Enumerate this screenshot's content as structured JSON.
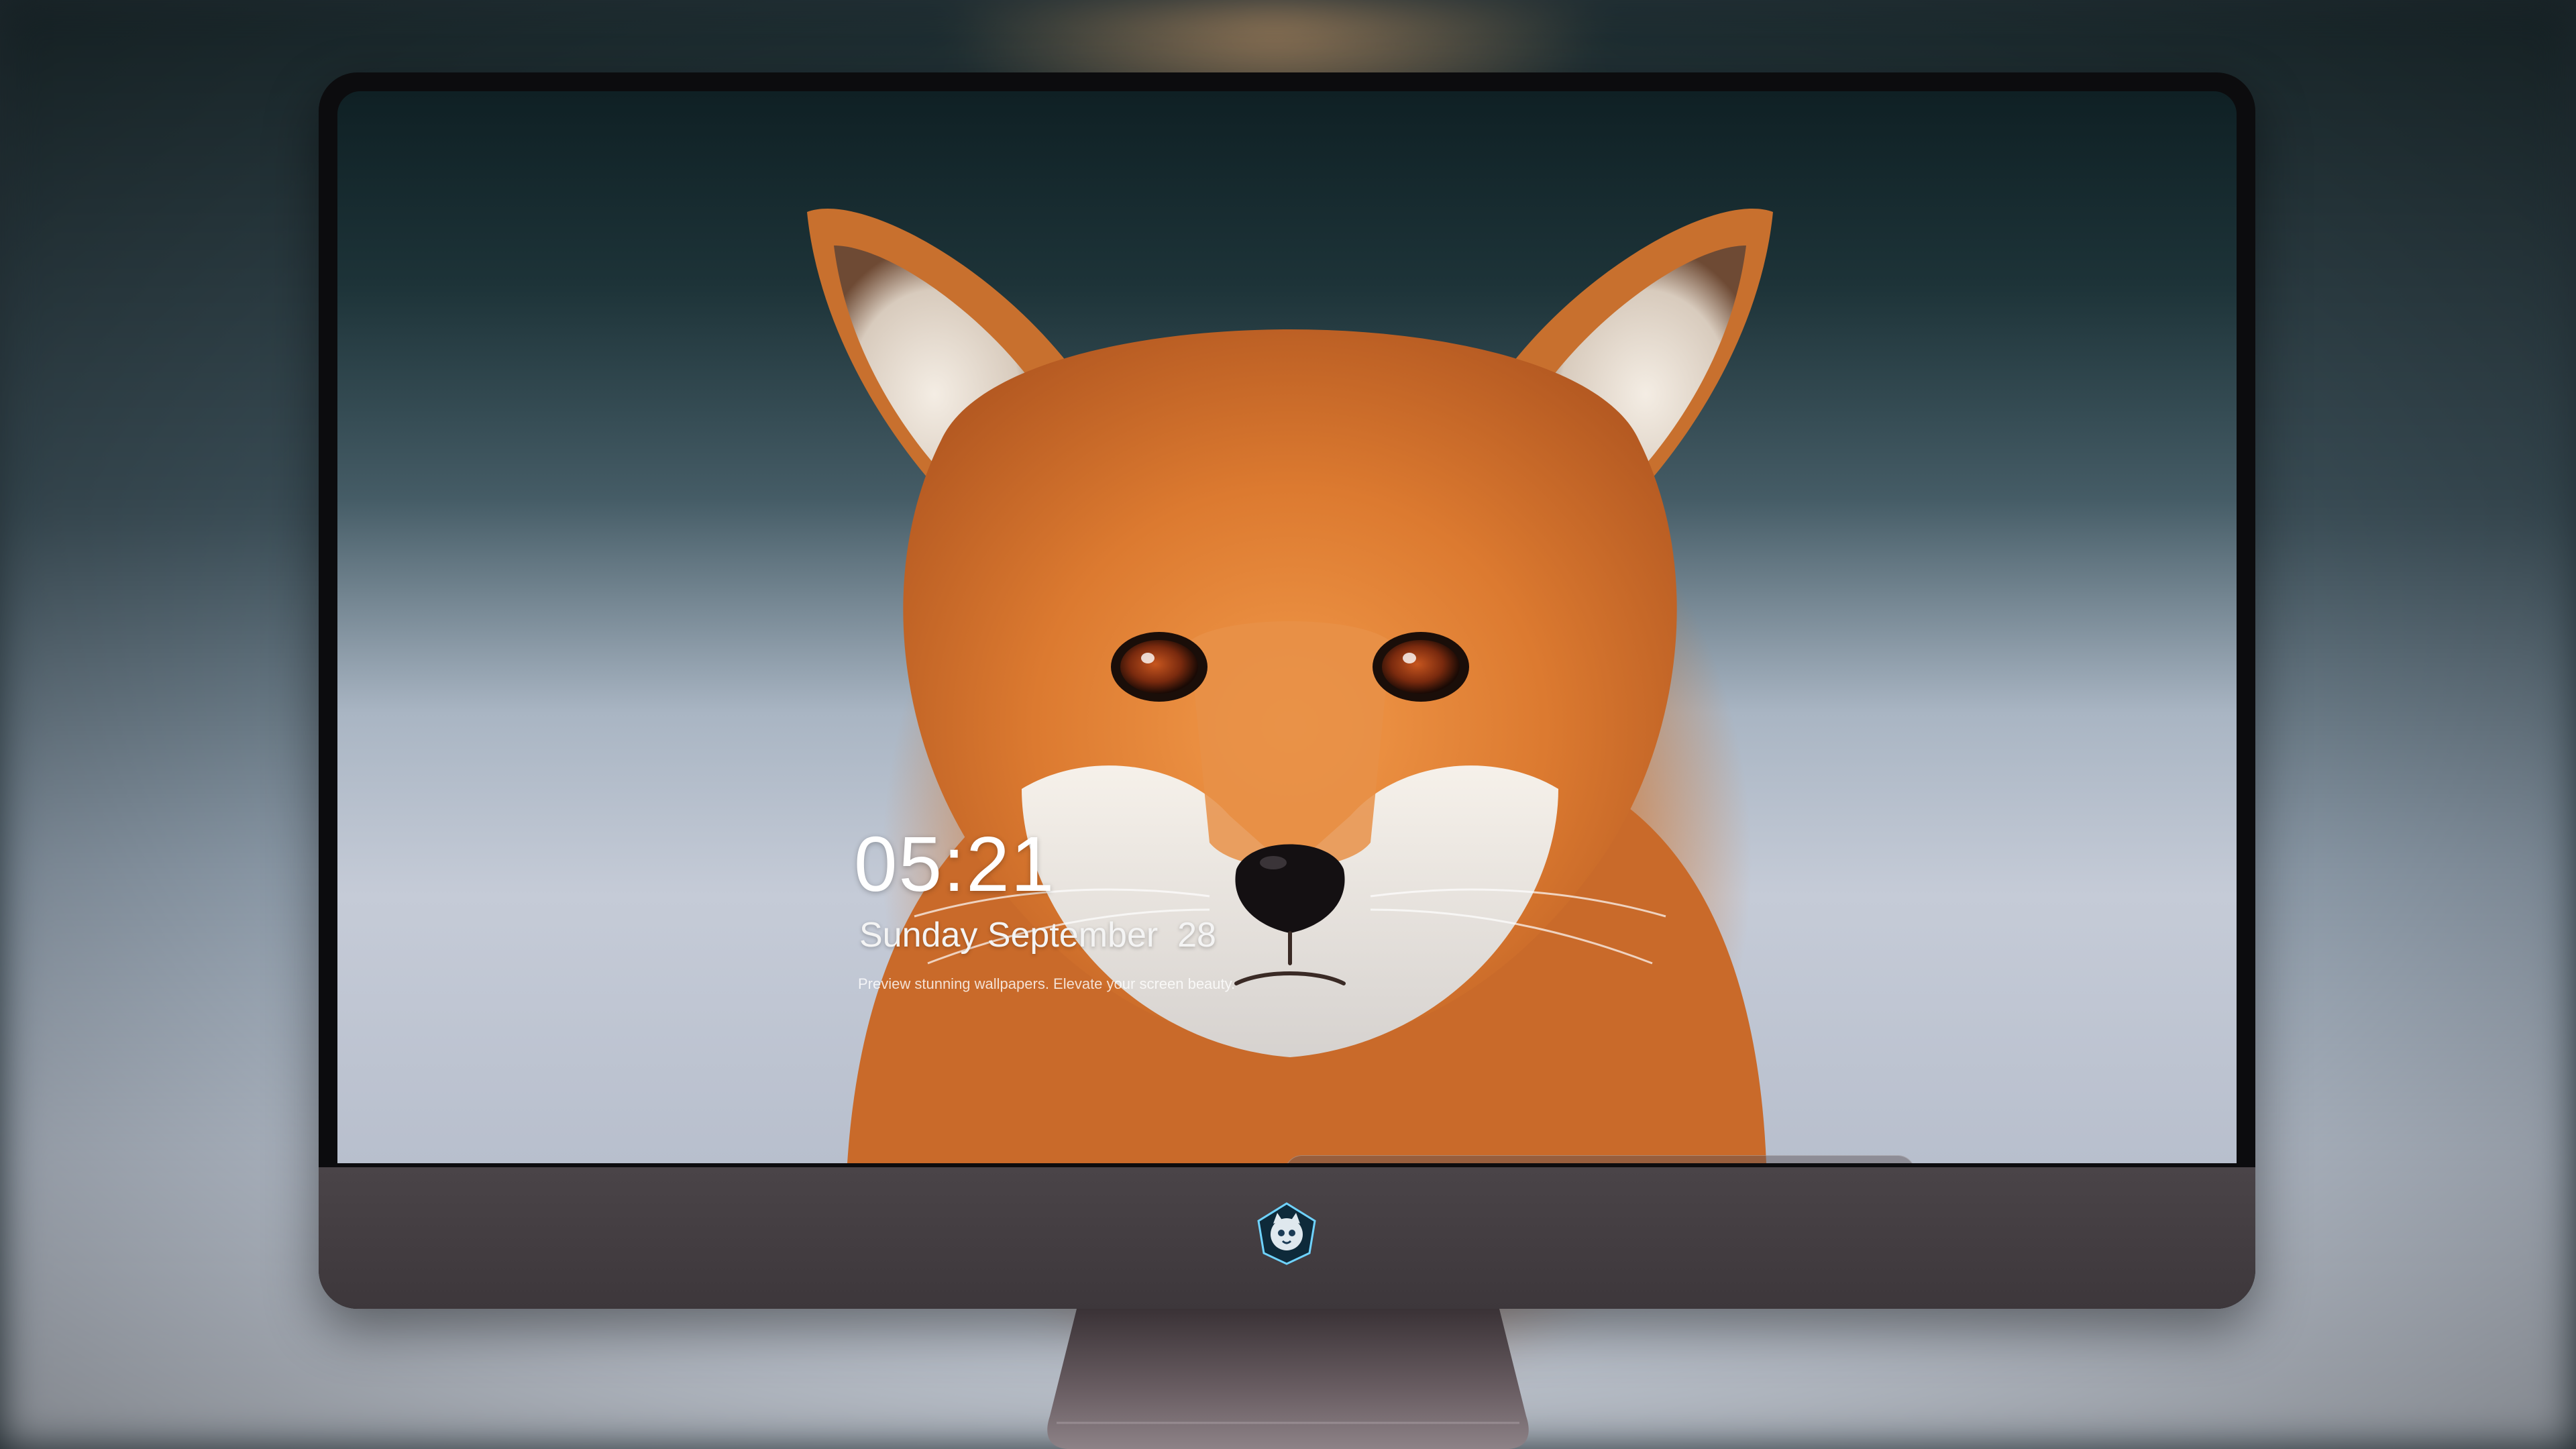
{
  "lockscreen": {
    "time": "05:21",
    "date": "Sunday September  28",
    "caption": "Preview stunning wallpapers. Elevate your screen beauty."
  },
  "dock": {
    "apps": [
      {
        "icon": "messages-icon",
        "color": "#2ecc50"
      },
      {
        "icon": "weather-icon",
        "color": "#2f8cf0"
      },
      {
        "icon": "clock-icon",
        "color": "#111111"
      },
      {
        "icon": "preview-icon",
        "color": "#f2b91d"
      },
      {
        "icon": "clips-icon",
        "color": "#3aa0e8"
      },
      {
        "icon": "notes-icon",
        "color": "#ffd84a"
      },
      {
        "icon": "photo-booth-icon",
        "color": "#e8e8e8"
      },
      {
        "icon": "music-icon",
        "color": "#e84bd6"
      },
      {
        "icon": "app-store-icon",
        "color": "#1d8cf5"
      },
      {
        "icon": "camera-icon",
        "color": "#6f6f6f"
      }
    ]
  },
  "monitor": {
    "logo": "cat-mascot-logo"
  }
}
